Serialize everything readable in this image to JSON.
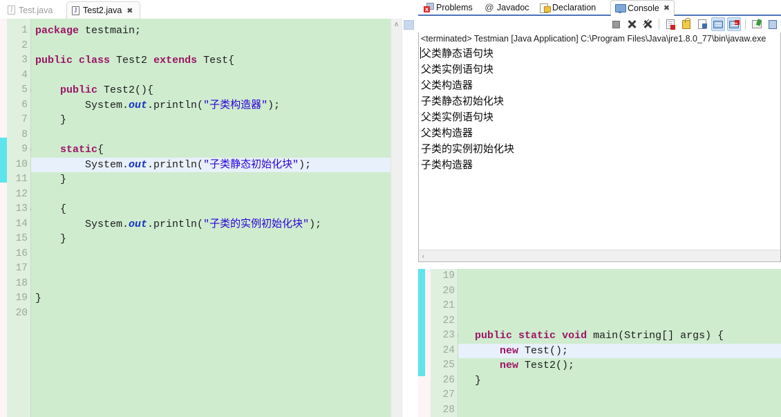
{
  "editor_tabs": [
    {
      "label": "Test.java",
      "icon": "java-file-icon",
      "active": false,
      "dirty": false
    },
    {
      "label": "Test2.java",
      "icon": "java-file-icon",
      "active": true,
      "close": "✖"
    }
  ],
  "left_editor": {
    "first_line": 1,
    "highlight_line": 10,
    "lines": [
      {
        "n": "1",
        "fold": false,
        "html": "<span class=\"kw\">package</span> testmain;"
      },
      {
        "n": "2",
        "fold": false,
        "html": ""
      },
      {
        "n": "3",
        "fold": false,
        "html": "<span class=\"kw\">public</span> <span class=\"kw\">class</span> Test2 <span class=\"kw\">extends</span> Test{"
      },
      {
        "n": "4",
        "fold": false,
        "html": ""
      },
      {
        "n": "5",
        "fold": true,
        "html": "    <span class=\"kw\">public</span> Test2(){"
      },
      {
        "n": "6",
        "fold": false,
        "html": "        System.<span class=\"fld\">out</span>.println(<span class=\"str\">\"子类构造器\"</span>);"
      },
      {
        "n": "7",
        "fold": false,
        "html": "    }"
      },
      {
        "n": "8",
        "fold": false,
        "html": ""
      },
      {
        "n": "9",
        "fold": true,
        "html": "    <span class=\"kw\">static</span>{"
      },
      {
        "n": "10",
        "fold": false,
        "html": "        System.<span class=\"fld\">out</span>.println(<span class=\"str\">\"子类静态初始化块\"</span>);"
      },
      {
        "n": "11",
        "fold": false,
        "html": "    }"
      },
      {
        "n": "12",
        "fold": false,
        "html": ""
      },
      {
        "n": "13",
        "fold": true,
        "html": "    {"
      },
      {
        "n": "14",
        "fold": false,
        "html": "        System.<span class=\"fld\">out</span>.println(<span class=\"str\">\"子类的实例初始化块\"</span>);"
      },
      {
        "n": "15",
        "fold": false,
        "html": "    }"
      },
      {
        "n": "16",
        "fold": false,
        "html": ""
      },
      {
        "n": "17",
        "fold": false,
        "html": ""
      },
      {
        "n": "18",
        "fold": false,
        "html": ""
      },
      {
        "n": "19",
        "fold": false,
        "html": "}"
      },
      {
        "n": "20",
        "fold": false,
        "html": ""
      }
    ]
  },
  "view_tabs": [
    {
      "label": "Problems",
      "icon": "problems-icon",
      "active": false
    },
    {
      "label": "Javadoc",
      "icon": "javadoc-at-icon",
      "active": false
    },
    {
      "label": "Declaration",
      "icon": "declaration-icon",
      "active": false
    },
    {
      "label": "Console",
      "icon": "console-icon",
      "active": true,
      "close": "✖"
    }
  ],
  "console_toolbar": [
    {
      "name": "terminate-button",
      "icon": "stop-square-icon",
      "pressed": false
    },
    {
      "name": "remove-launch-button",
      "icon": "remove-x-icon",
      "pressed": false
    },
    {
      "name": "remove-all-terminated-button",
      "icon": "remove-all-xx-icon",
      "pressed": false
    },
    {
      "name": "clear-console-button",
      "icon": "clear-console-icon",
      "pressed": false
    },
    {
      "name": "scroll-lock-button",
      "icon": "scroll-lock-icon",
      "pressed": false
    },
    {
      "name": "word-wrap-button",
      "icon": "word-wrap-icon",
      "pressed": false
    },
    {
      "name": "show-console-on-output-button",
      "icon": "console-out-icon",
      "pressed": true
    },
    {
      "name": "show-console-on-error-button",
      "icon": "console-err-icon",
      "pressed": true
    },
    {
      "name": "pin-console-button",
      "icon": "pin-console-icon",
      "pressed": false
    },
    {
      "name": "display-selected-console-button",
      "icon": "display-console-icon",
      "pressed": false
    }
  ],
  "console": {
    "header": "<terminated> Testmian [Java Application] C:\\Program Files\\Java\\jre1.8.0_77\\bin\\javaw.exe",
    "lines": [
      "父类静态语句块",
      "父类实例语句块",
      "父类构造器",
      "子类静态初始化块",
      "父类实例语句块",
      "父类构造器",
      "子类的实例初始化块",
      "子类构造器"
    ],
    "scroll_left_arrow": "‹"
  },
  "bottom_editor": {
    "highlight_line": 24,
    "lines": [
      {
        "n": "19",
        "fold": false,
        "html": "",
        "clipped": true
      },
      {
        "n": "20",
        "fold": false,
        "html": ""
      },
      {
        "n": "21",
        "fold": false,
        "html": ""
      },
      {
        "n": "22",
        "fold": false,
        "html": ""
      },
      {
        "n": "23",
        "fold": true,
        "html": "  <span class=\"kw\">public</span> <span class=\"kw\">static</span> <span class=\"kw\">void</span> main(String[] args) {"
      },
      {
        "n": "24",
        "fold": false,
        "html": "      <span class=\"kw\">new</span> Test();"
      },
      {
        "n": "25",
        "fold": false,
        "html": "      <span class=\"kw\">new</span> Test2();"
      },
      {
        "n": "26",
        "fold": false,
        "html": "  }"
      },
      {
        "n": "27",
        "fold": false,
        "html": ""
      },
      {
        "n": "28",
        "fold": false,
        "html": ""
      }
    ]
  },
  "scrollbars": {
    "left_editor_up_arrow": "∧"
  },
  "colors": {
    "code_background": "#cfeccf",
    "gutter_background": "#dff0df",
    "current_line": "#e8f0fb",
    "keyword": "#9c1464",
    "string": "#2a00d6",
    "field": "#1431c4",
    "marker_bar": "#41e0ea",
    "active_tab_underline": "#4a74b8"
  }
}
